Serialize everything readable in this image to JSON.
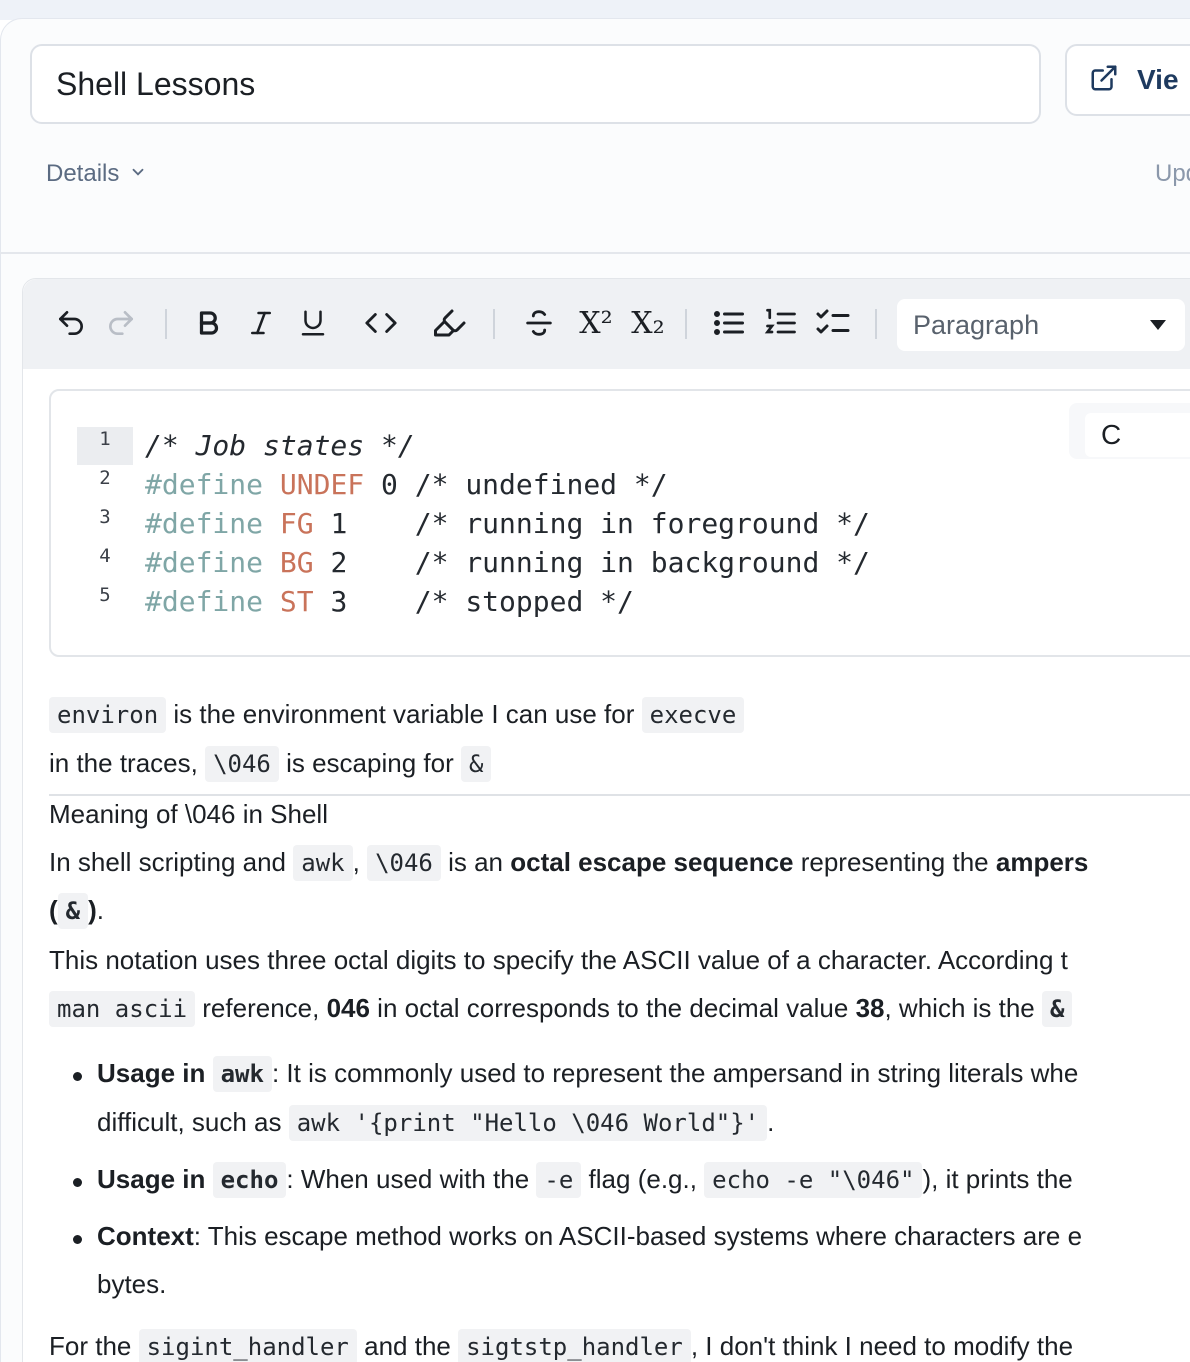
{
  "header": {
    "title_value": "Shell Lessons",
    "view_button_label": "Vie",
    "details_label": "Details",
    "updated_label": "Upd"
  },
  "toolbar": {
    "block_type": "Paragraph",
    "superscript_glyph": "X²",
    "subscript_glyph": "X₂"
  },
  "code_block": {
    "language": "C",
    "line_numbers": [
      "1",
      "2",
      "3",
      "4",
      "5"
    ],
    "lines": [
      {
        "comment": "/* Job states */"
      },
      {
        "kw": "#define",
        "name": "UNDEF",
        "value": "0",
        "pad": " ",
        "comment": "/* undefined */"
      },
      {
        "kw": "#define",
        "name": "FG",
        "value": "1",
        "pad": "    ",
        "comment": "/* running in foreground */"
      },
      {
        "kw": "#define",
        "name": "BG",
        "value": "2",
        "pad": "    ",
        "comment": "/* running in background */"
      },
      {
        "kw": "#define",
        "name": "ST",
        "value": "3",
        "pad": "    ",
        "comment": "/* stopped */"
      }
    ]
  },
  "content": {
    "p1": {
      "code1": "environ",
      "text1": " is the environment variable I can use for ",
      "code2": "execve"
    },
    "p2": {
      "text1": "in the traces, ",
      "code1": "\\046",
      "text2": " is escaping for ",
      "code2": "&"
    },
    "heading": "Meaning of \\046 in Shell",
    "p3": {
      "text1": "In shell scripting and ",
      "code1": "awk",
      "text2": ", ",
      "code2": "\\046",
      "text3": " is an ",
      "bold1": "octal escape sequence",
      "text4": " representing the ",
      "bold2": "ampers"
    },
    "p3b": {
      "bold_open": "(",
      "code": "&",
      "bold_close": ")",
      "text": "."
    },
    "p4": {
      "text1": "This notation uses three octal digits to specify the ASCII value of a character. According t"
    },
    "p5": {
      "code1": "man ascii",
      "text1": " reference, ",
      "bold1": "046",
      "text2": " in octal corresponds to the decimal value ",
      "bold2": "38",
      "text3": ", which is the ",
      "code2": "&"
    },
    "bullets": [
      {
        "bold": "Usage in ",
        "code": "awk",
        "text": ": It is commonly used to represent the ampersand in string literals whe",
        "line2_text": "difficult, such as ",
        "line2_code": "awk '{print \"Hello \\046 World\"}'",
        "line2_end": "."
      },
      {
        "bold": "Usage in ",
        "code": "echo",
        "text": ": When used with the ",
        "code2": "-e",
        "text2": " flag (e.g., ",
        "code3": "echo -e \"\\046\"",
        "text3": "), it prints the "
      },
      {
        "bold": "Context",
        "text": ": This escape method works on ASCII-based systems where characters are e",
        "line2_text": "bytes."
      }
    ],
    "p6": {
      "text1": "For the ",
      "code1": "sigint_handler",
      "text2": " and the ",
      "code2": "sigtstp_handler",
      "text3": ", I don't think I need to modify the"
    }
  }
}
